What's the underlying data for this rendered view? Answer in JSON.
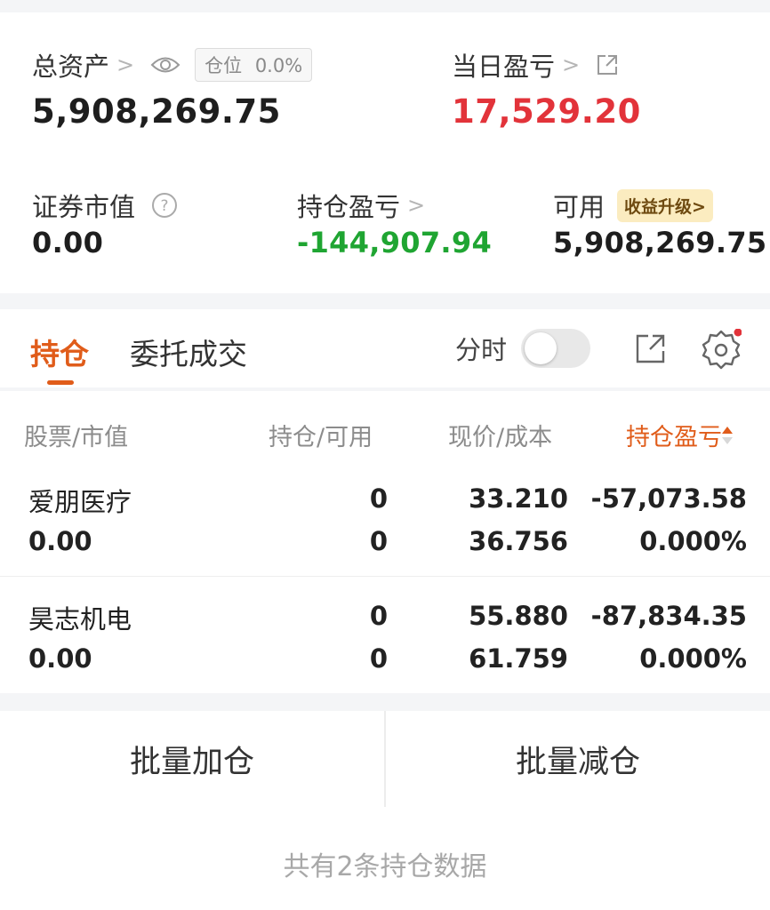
{
  "summary": {
    "total_assets_label": "总资产",
    "position_pill_label": "仓位",
    "position_pill_value": "0.0%",
    "total_assets_value": "5,908,269.75",
    "daily_pnl_label": "当日盈亏",
    "daily_pnl_value": "17,529.20",
    "market_value_label": "证券市值",
    "market_value_value": "0.00",
    "holding_pnl_label": "持仓盈亏",
    "holding_pnl_value": "-144,907.94",
    "available_label": "可用",
    "available_badge": "收益升级>",
    "available_value": "5,908,269.75"
  },
  "tabs": {
    "holdings": "持仓",
    "orders": "委托成交",
    "intraday_label": "分时"
  },
  "table": {
    "headers": [
      "股票/市值",
      "持仓/可用",
      "现价/成本",
      "持仓盈亏"
    ],
    "rows": [
      {
        "name": "爱朋医疗",
        "market_value": "0.00",
        "holding": "0",
        "available": "0",
        "price": "33.210",
        "cost": "36.756",
        "pnl": "-57,073.58",
        "pnl_pct": "0.000%"
      },
      {
        "name": "昊志机电",
        "market_value": "0.00",
        "holding": "0",
        "available": "0",
        "price": "55.880",
        "cost": "61.759",
        "pnl": "-87,834.35",
        "pnl_pct": "0.000%"
      }
    ]
  },
  "actions": {
    "batch_add": "批量加仓",
    "batch_reduce": "批量减仓"
  },
  "footer": {
    "summary": "共有2条持仓数据"
  },
  "colors": {
    "accent": "#e05c1a",
    "loss_red": "#e2333a",
    "gain_green": "#1fa532"
  },
  "icons": [
    "eye-icon",
    "external-link-icon",
    "help-icon",
    "share-icon",
    "settings-icon",
    "sort-icon"
  ]
}
